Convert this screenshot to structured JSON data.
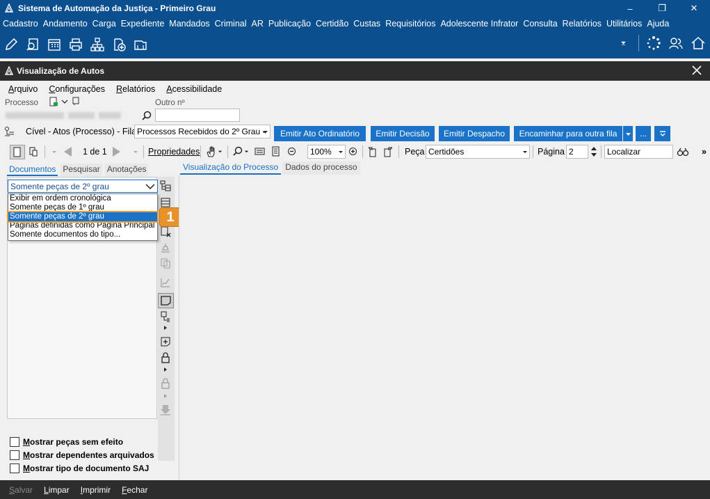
{
  "window": {
    "title": "Sistema de Automação da Justiça - Primeiro Grau",
    "controls": [
      "–",
      "❐",
      "✕"
    ]
  },
  "menubar": {
    "items": [
      "Cadastro",
      "Andamento",
      "Carga",
      "Expediente",
      "Mandados",
      "Criminal",
      "AR",
      "Publicação",
      "Certidão",
      "Custas",
      "Requisitórios",
      "Adolescente Infrator",
      "Consulta",
      "Relatórios",
      "Utilitários",
      "Ajuda"
    ]
  },
  "toolbar_icons": [
    "edit-icon",
    "search-document-icon",
    "calendar-icon",
    "print-icon",
    "hierarchy-icon",
    "add-document-icon",
    "inbox-icon"
  ],
  "inner_window": {
    "title": "Visualização de Autos",
    "menu": [
      "Arquivo",
      "Configurações",
      "Relatórios",
      "Acessibilidade"
    ]
  },
  "process": {
    "processo_label": "Processo",
    "outro_label": "Outro nº",
    "outro_value": ""
  },
  "fila": {
    "label": "Cível - Atos (Processo) - Fila:",
    "selected": "Processos Recebidos do 2º Grau -",
    "buttons": [
      "Emitir Ato Ordinatório",
      "Emitir Decisão",
      "Emitir Despacho",
      "Encaminhar para outra fila",
      "..."
    ]
  },
  "viewer_toolbar": {
    "page_indicator": "1 de 1",
    "properties_label": "Propriedades",
    "zoom": "100%",
    "peca_label": "Peça",
    "peca_value": "Certidões",
    "pagina_label": "Página",
    "pagina_value": "2",
    "localizar_placeholder": "Localizar",
    "overflow": "»"
  },
  "left_tabs": [
    "Documentos",
    "Pesquisar",
    "Anotações"
  ],
  "doc_filter": {
    "selected": "Somente peças de 2º grau",
    "options": [
      "Exibir em ordem cronológica",
      "Somente peças de 1º grau",
      "Somente peças de 2º grau",
      "Páginas definidas como Página Principal",
      "Somente documentos do tipo..."
    ],
    "highlighted_index": 2
  },
  "callout": {
    "label": "1",
    "color": "#e8922c"
  },
  "right_tabs": [
    "Visualização do Processo",
    "Dados do processo"
  ],
  "checkboxes": [
    {
      "label": "Mostrar peças sem efeito",
      "checked": false
    },
    {
      "label": "Mostrar dependentes arquivados",
      "checked": false
    },
    {
      "label": "Mostrar tipo de documento SAJ",
      "checked": false
    }
  ],
  "bottom_bar": {
    "items": [
      {
        "label": "Salvar",
        "enabled": false
      },
      {
        "label": "Limpar",
        "enabled": true
      },
      {
        "label": "Imprimir",
        "enabled": true
      },
      {
        "label": "Fechar",
        "enabled": true
      }
    ]
  },
  "colors": {
    "title_blue": "#0b4f8f",
    "accent_blue": "#1a73c9",
    "dark_bar": "#2d2d2d"
  }
}
